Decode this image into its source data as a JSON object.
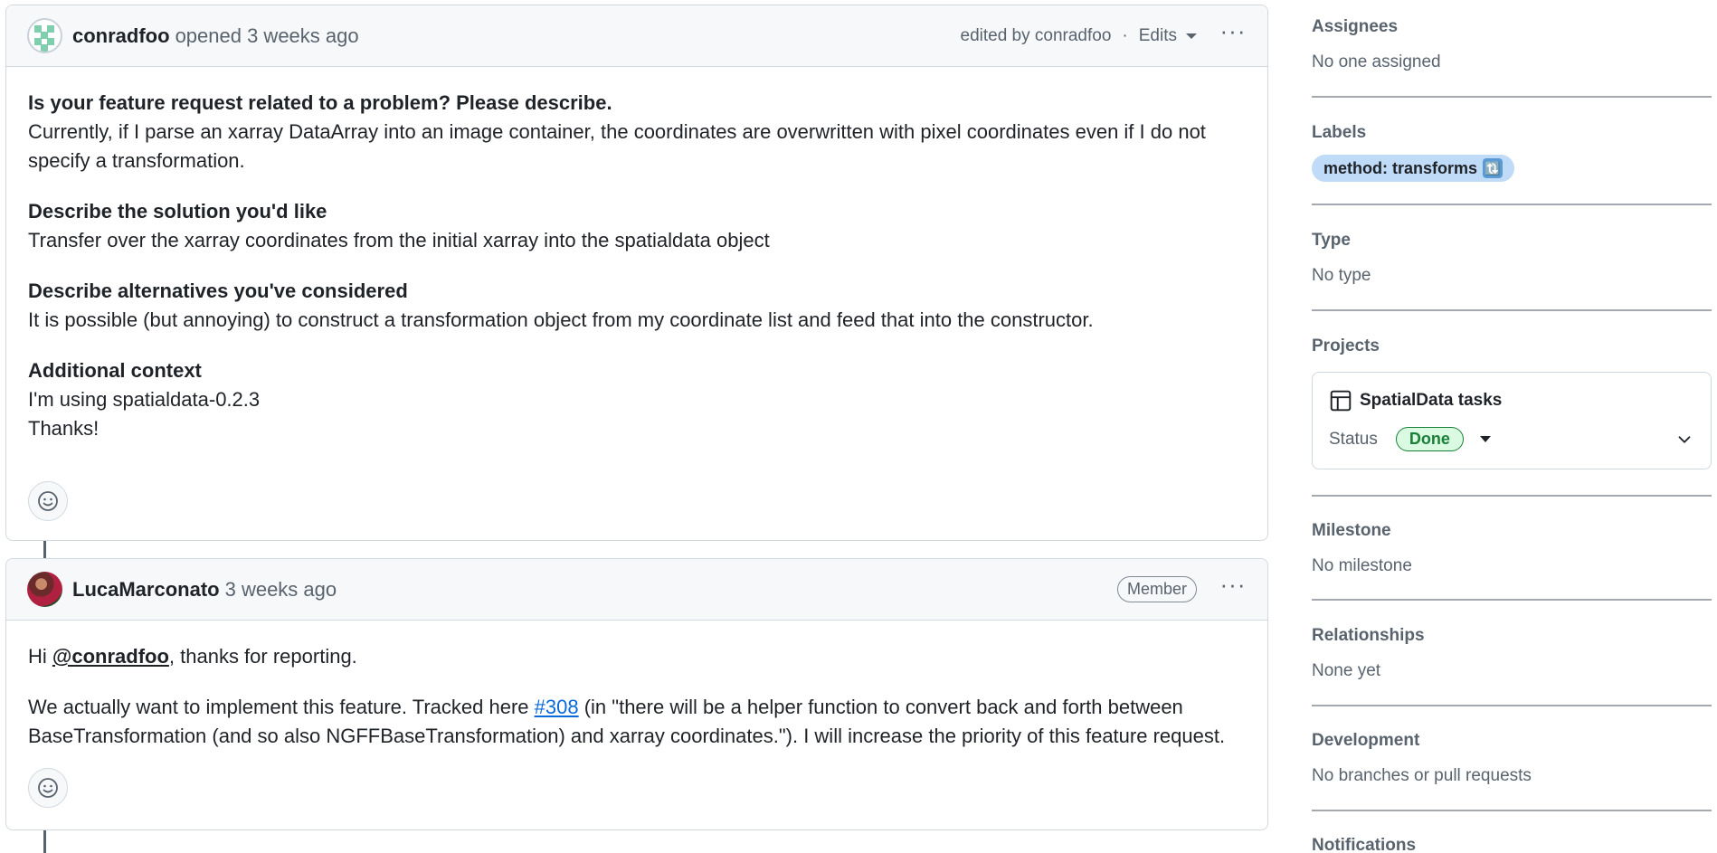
{
  "comments": [
    {
      "author": "conradfoo",
      "meta": "opened 3 weeks ago",
      "edited": "edited by conradfoo",
      "separator": "·",
      "edits_label": "Edits",
      "body": {
        "h1": "Is your feature request related to a problem? Please describe.",
        "p1": "Currently, if I parse an xarray DataArray into an image container, the coordinates are overwritten with pixel coordinates even if I do not specify a transformation.",
        "h2": "Describe the solution you'd like",
        "p2": "Transfer over the xarray coordinates from the initial xarray into the spatialdata object",
        "h3": "Describe alternatives you've considered",
        "p3": "It is possible (but annoying) to construct a transformation object from my coordinate list and feed that into the constructor.",
        "h4": "Additional context",
        "p4a": "I'm using spatialdata-0.2.3",
        "p4b": "Thanks!"
      }
    },
    {
      "author": "LucaMarconato",
      "meta": "3 weeks ago",
      "badge": "Member",
      "body": {
        "hi": "Hi ",
        "mention": "@conradfoo",
        "hi_rest": ", thanks for reporting.",
        "p2_start": "We actually want to implement this feature. Tracked here ",
        "link": "#308",
        "p2_end": " (in \"there will be a helper function to convert back and forth between BaseTransformation (and so also NGFFBaseTransformation) and xarray coordinates.\"). I will increase the priority of this feature request."
      }
    }
  ],
  "sidebar": {
    "assignees": {
      "title": "Assignees",
      "value": "No one assigned"
    },
    "labels": {
      "title": "Labels",
      "chip": "method: transforms",
      "chip_emoji": "🔃"
    },
    "type": {
      "title": "Type",
      "value": "No type"
    },
    "projects": {
      "title": "Projects",
      "name": "SpatialData tasks",
      "status_label": "Status",
      "status_value": "Done"
    },
    "milestone": {
      "title": "Milestone",
      "value": "No milestone"
    },
    "relationships": {
      "title": "Relationships",
      "value": "None yet"
    },
    "development": {
      "title": "Development",
      "value": "No branches or pull requests"
    },
    "notifications": {
      "title": "Notifications"
    }
  },
  "icons": {
    "more": "kebab-horizontal-icon",
    "react": "smiley-icon",
    "project": "table-icon",
    "dropdown": "triangle-down-icon",
    "expand": "chevron-down-icon"
  },
  "colors": {
    "label_bg": "#bfdbf7",
    "done_green": "#1a7f37",
    "link_blue": "#0969da"
  }
}
